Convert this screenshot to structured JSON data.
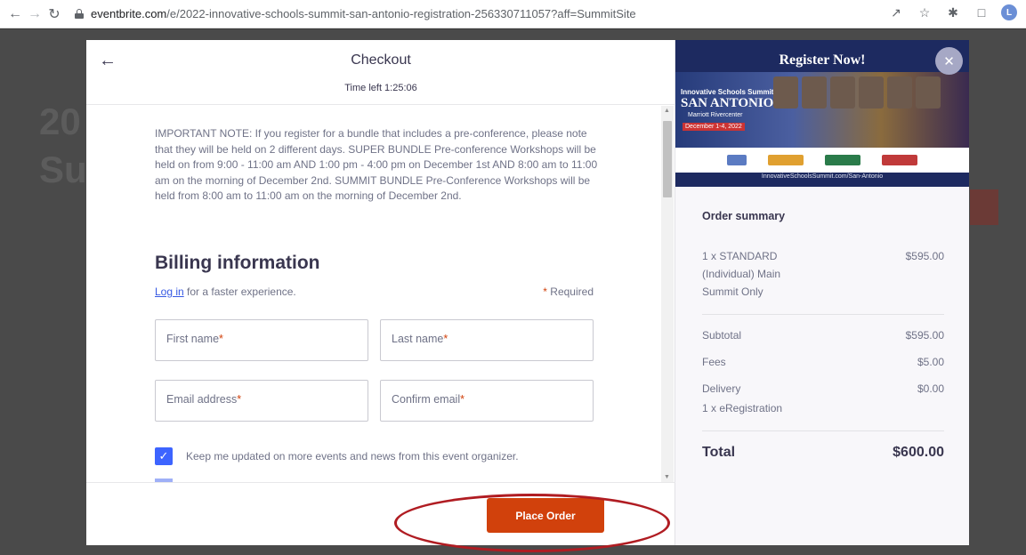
{
  "browser": {
    "url_host": "eventbrite.com",
    "url_path": "/e/2022-innovative-schools-summit-san-antonio-registration-256330711057?aff=SummitSite",
    "profile_initial": "L"
  },
  "background": {
    "text1": "20",
    "text2": "Su"
  },
  "checkout": {
    "title": "Checkout",
    "time_left": "Time left 1:25:06",
    "important_note": "IMPORTANT NOTE: If you register for a bundle that includes a pre-conference, please note that they will be held on 2 different days. SUPER BUNDLE Pre-conference Workshops will be held on from 9:00 - 11:00 am AND 1:00 pm - 4:00 pm on December 1st AND 8:00 am to 11:00 am on the morning of December 2nd. SUMMIT BUNDLE Pre-Conference Workshops will be held from 8:00 am to 11:00 am on the morning of December 2nd.",
    "billing_title": "Billing information",
    "login_link": "Log in",
    "login_suffix": " for a faster experience.",
    "required_label": "Required",
    "fields": {
      "first_name": "First name",
      "last_name": "Last name",
      "email": "Email address",
      "confirm_email": "Confirm email"
    },
    "checkbox_label": "Keep me updated on more events and news from this event organizer.",
    "checkbox_checked": true,
    "place_order_label": "Place Order"
  },
  "banner": {
    "title": "Register Now!",
    "event_name": "Innovative Schools Summit",
    "city": "SAN ANTONIO",
    "venue": "Marriott Rivercenter",
    "date": "December 1-4, 2022",
    "website": "InnovativeSchoolsSummit.com/San-Antonio"
  },
  "order_summary": {
    "title": "Order summary",
    "item_name": "1 x STANDARD (Individual) Main Summit Only",
    "item_price": "$595.00",
    "subtotal_label": "Subtotal",
    "subtotal_value": "$595.00",
    "fees_label": "Fees",
    "fees_value": "$5.00",
    "delivery_label": "Delivery",
    "delivery_value": "$0.00",
    "delivery_detail": "1 x eRegistration",
    "total_label": "Total",
    "total_value": "$600.00"
  },
  "colors": {
    "accent": "#d1410c",
    "checkbox": "#3d64ff",
    "highlight_circle": "#b01c22"
  }
}
